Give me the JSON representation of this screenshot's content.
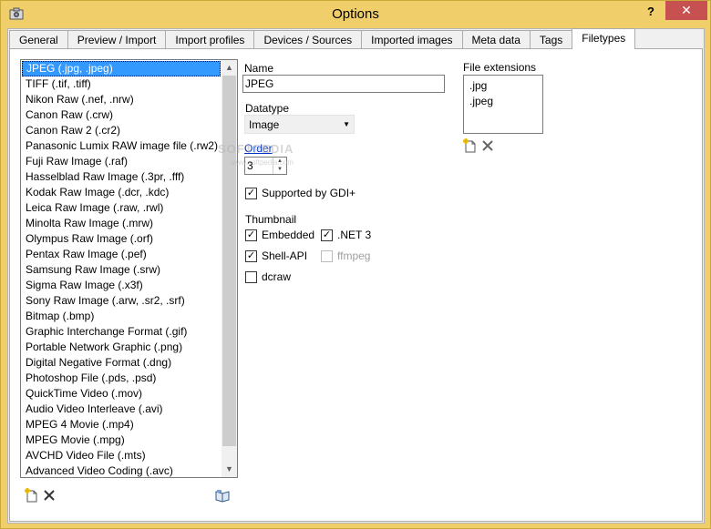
{
  "window": {
    "title": "Options",
    "help_label": "?",
    "close_label": "✕"
  },
  "tabs": [
    {
      "label": "General"
    },
    {
      "label": "Preview / Import"
    },
    {
      "label": "Import profiles"
    },
    {
      "label": "Devices / Sources"
    },
    {
      "label": "Imported images"
    },
    {
      "label": "Meta data"
    },
    {
      "label": "Tags"
    },
    {
      "label": "Filetypes"
    }
  ],
  "filetypes": [
    "JPEG (.jpg, .jpeg)",
    "TIFF (.tif, .tiff)",
    "Nikon Raw (.nef, .nrw)",
    "Canon Raw (.crw)",
    "Canon Raw 2 (.cr2)",
    "Panasonic Lumix RAW image file (.rw2)",
    "Fuji Raw Image (.raf)",
    "Hasselblad Raw Image (.3pr, .fff)",
    "Kodak Raw Image (.dcr, .kdc)",
    "Leica Raw Image (.raw, .rwl)",
    "Minolta Raw Image (.mrw)",
    "Olympus Raw Image (.orf)",
    "Pentax Raw Image (.pef)",
    "Samsung Raw Image (.srw)",
    "Sigma Raw Image (.x3f)",
    "Sony Raw Image (.arw, .sr2, .srf)",
    "Bitmap (.bmp)",
    "Graphic Interchange Format (.gif)",
    "Portable Network Graphic (.png)",
    "Digital Negative Format (.dng)",
    "Photoshop File (.pds, .psd)",
    "QuickTime Video (.mov)",
    "Audio Video Interleave (.avi)",
    "MPEG 4 Movie (.mp4)",
    "MPEG Movie (.mpg)",
    "AVCHD Video File (.mts)",
    "Advanced Video Coding (.avc)"
  ],
  "detail": {
    "name_label": "Name",
    "name_value": "JPEG",
    "datatype_label": "Datatype",
    "datatype_value": "Image",
    "order_label": "Order",
    "order_value": "3",
    "gdi_label": "Supported by GDI+",
    "thumbnail_label": "Thumbnail",
    "embedded_label": "Embedded",
    "net3_label": ".NET 3",
    "shellapi_label": "Shell-API",
    "ffmpeg_label": "ffmpeg",
    "dcraw_label": "dcraw",
    "ext_label": "File extensions",
    "extensions": [
      ".jpg",
      ".jpeg"
    ]
  },
  "watermark": {
    "text": "SOFTPEDIA",
    "url": "www.softpedia.com"
  }
}
